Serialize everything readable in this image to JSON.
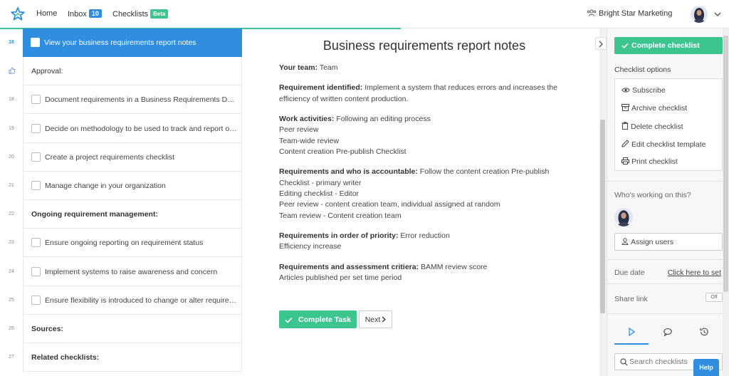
{
  "nav": {
    "home": "Home",
    "inbox": "Inbox",
    "inbox_count": "10",
    "checklists": "Checklists",
    "beta": "Beta",
    "org": "Bright Star Marketing",
    "progress": 0.55
  },
  "steps": [
    {
      "num": "18",
      "label": "View your business requirements report notes",
      "type": "task",
      "active": true
    },
    {
      "num": "",
      "label": "Approval:",
      "type": "approval"
    },
    {
      "num": "18",
      "label": "Document requirements in a Business Requirements Document",
      "type": "task"
    },
    {
      "num": "19",
      "label": "Decide on methodology to be used to track and report on requirements",
      "type": "task"
    },
    {
      "num": "20",
      "label": "Create a project requirements checklist",
      "type": "task"
    },
    {
      "num": "21",
      "label": "Manage change in your organization",
      "type": "task"
    },
    {
      "num": "22",
      "label": "Ongoing requirement management:",
      "type": "heading"
    },
    {
      "num": "23",
      "label": "Ensure ongoing reporting on requirement status",
      "type": "task"
    },
    {
      "num": "24",
      "label": "Implement systems to raise awareness and concern",
      "type": "task"
    },
    {
      "num": "25",
      "label": "Ensure flexibility is introduced to change or alter requirements",
      "type": "task"
    },
    {
      "num": "26",
      "label": "Sources:",
      "type": "heading"
    },
    {
      "num": "27",
      "label": "Related checklists:",
      "type": "heading"
    }
  ],
  "content": {
    "title": "Business requirements report notes",
    "sections": [
      {
        "label": "Your team:",
        "lines": [
          "Team"
        ]
      },
      {
        "label": "Requirement identified:",
        "lines": [
          "Implement a system that reduces errors and increases the efficiency of written content production."
        ]
      },
      {
        "label": "Work activities:",
        "lines": [
          "Following an editing process",
          "Peer review",
          "Team-wide review",
          "Content creation Pre-publish Checklist"
        ]
      },
      {
        "label": "Requirements and who is accountable:",
        "lines": [
          "Follow the content creation Pre-publish",
          "Checklist - primary writer",
          "Editing checklist - Editor",
          "Peer review - content creation team, individual assigned at random",
          "Team review - Content creation team"
        ]
      },
      {
        "label": "Requirements in order of priority:",
        "lines": [
          "Error reduction",
          "Efficiency increase"
        ]
      },
      {
        "label": "Requirements and assessment critiera:",
        "lines": [
          "BAMM review score",
          "Articles published per set time period"
        ]
      }
    ],
    "complete_task": "Complete Task",
    "next": "Next"
  },
  "sidebar": {
    "complete_checklist": "Complete checklist",
    "options_title": "Checklist options",
    "options": [
      {
        "label": "Subscribe",
        "icon": "eye-icon"
      },
      {
        "label": "Archive checklist",
        "icon": "archive-icon"
      },
      {
        "label": "Delete checklist",
        "icon": "trash-icon"
      },
      {
        "label": "Edit checklist template",
        "icon": "pencil-icon"
      },
      {
        "label": "Print checklist",
        "icon": "printer-icon"
      }
    ],
    "working_title": "Who's working on this?",
    "assign_users": "Assign users",
    "due_date": "Due date",
    "due_link": "Click here to set",
    "share_link": "Share link",
    "toggle": "Off",
    "search_placeholder": "Search checklists",
    "help": "Help"
  },
  "colors": {
    "accent_blue": "#2f8ee0",
    "accent_green": "#3cc58f"
  }
}
